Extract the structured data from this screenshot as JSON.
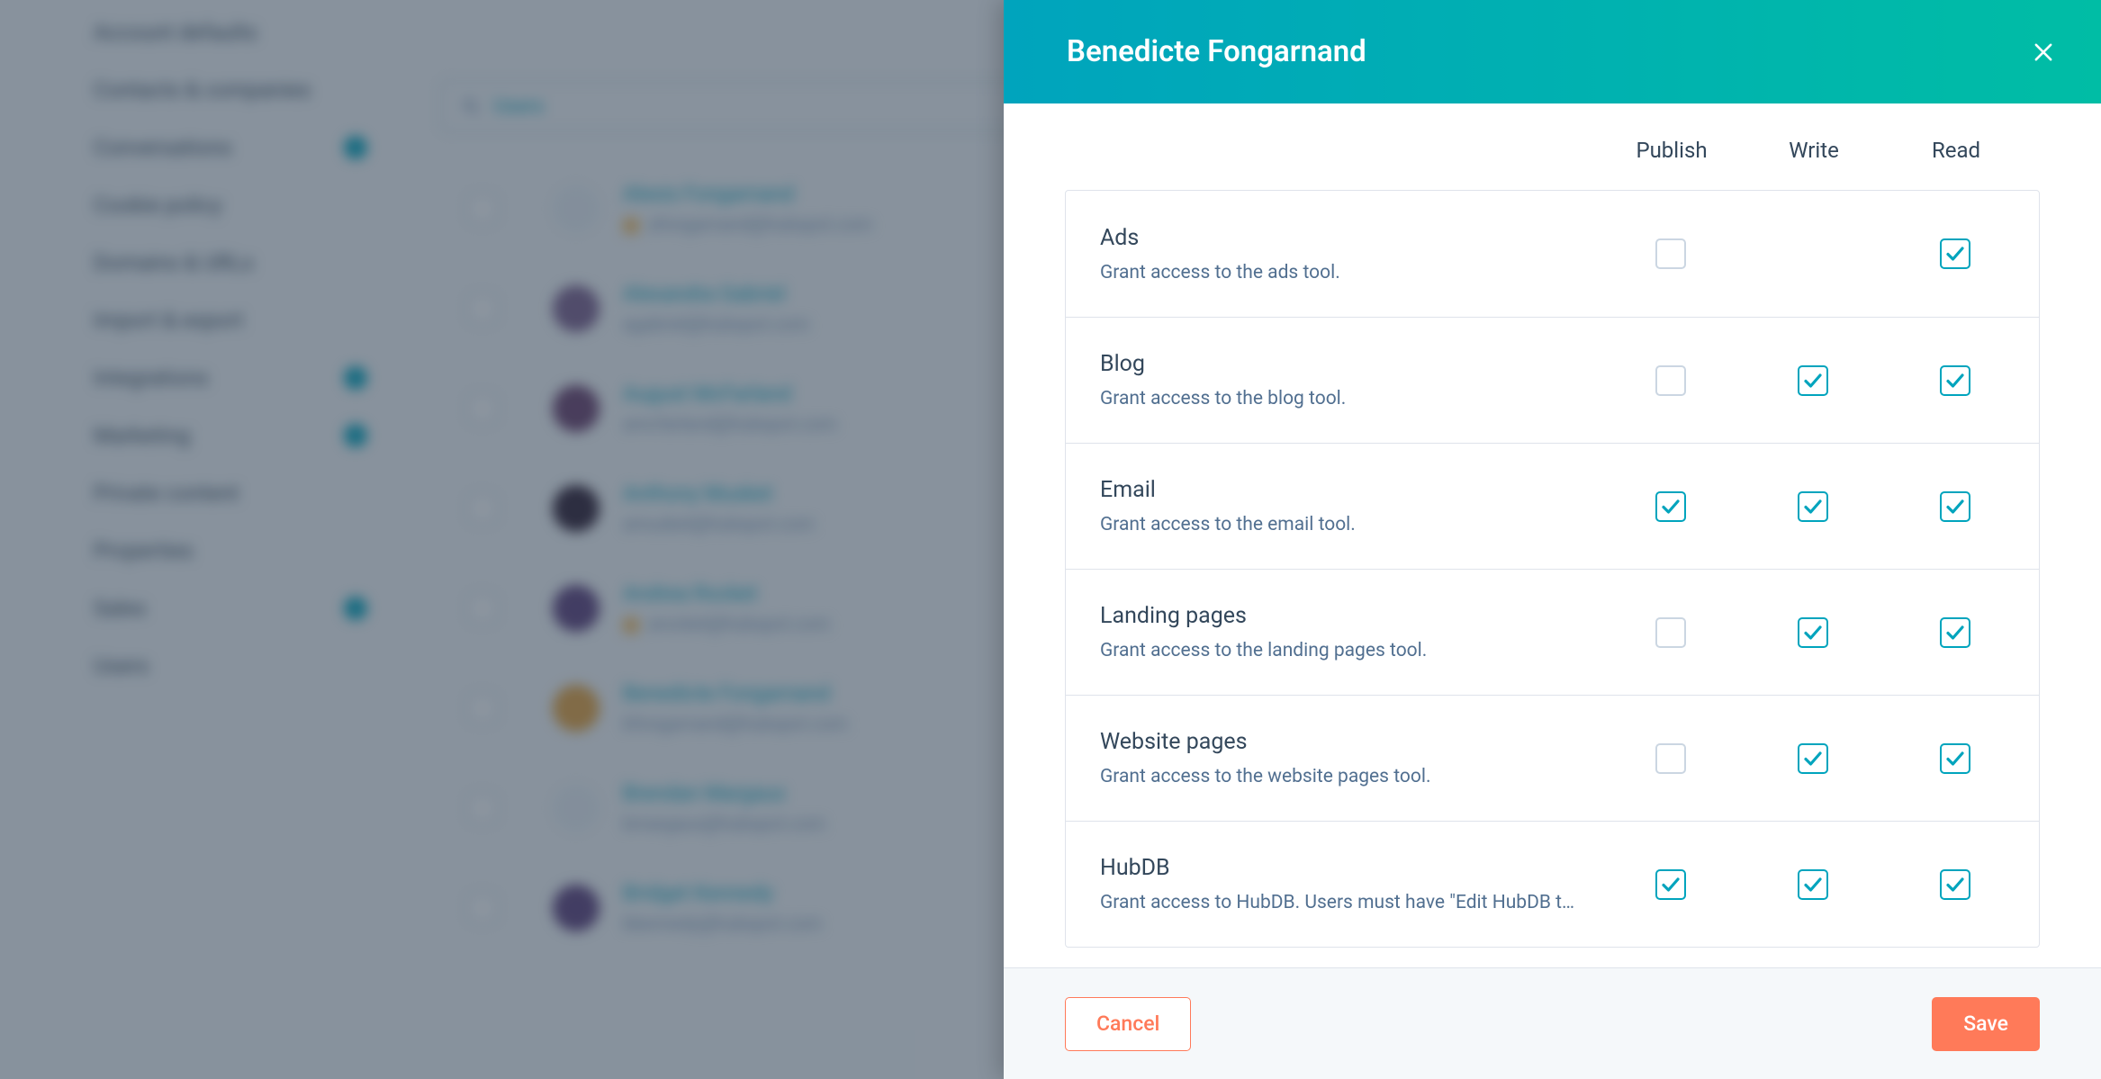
{
  "colors": {
    "accent_teal": "#00a4bd",
    "accent_orange": "#ff7a59",
    "text_primary": "#33475b",
    "text_secondary": "#516f90"
  },
  "background_page": {
    "sidebar": {
      "items": [
        {
          "label": "Account defaults",
          "badge": false
        },
        {
          "label": "Contacts & companies",
          "badge": false
        },
        {
          "label": "Conversations",
          "badge": true
        },
        {
          "label": "Cookie policy",
          "badge": false
        },
        {
          "label": "Domains & URLs",
          "badge": false
        },
        {
          "label": "Import & export",
          "badge": false
        },
        {
          "label": "Integrations",
          "badge": true
        },
        {
          "label": "Marketing",
          "badge": true
        },
        {
          "label": "Private content",
          "badge": false
        },
        {
          "label": "Properties",
          "badge": false
        },
        {
          "label": "Sales",
          "badge": true
        },
        {
          "label": "Users",
          "badge": false
        }
      ]
    },
    "search_text": "Users",
    "rows": [
      {
        "name": "Alexis Fongarnand",
        "email": "afongarnand@hubspot.com",
        "warn": true,
        "avatar_color": "#eaf0f6"
      },
      {
        "name": "Alexandra Gabriel",
        "email": "agabriel@hubspot.com",
        "warn": false,
        "avatar_color": "#7c5e8c"
      },
      {
        "name": "August McFarland",
        "email": "amcfarland@hubspot.com",
        "warn": false,
        "avatar_color": "#6a3d6a"
      },
      {
        "name": "Anthony Musket",
        "email": "amusket@hubspot.com",
        "warn": false,
        "avatar_color": "#2d1b2f"
      },
      {
        "name": "Andrea Rocket",
        "email": "arocket@hubspot.com",
        "warn": true,
        "avatar_color": "#5c3d7a"
      },
      {
        "name": "Benedicte Fongarnand",
        "email": "bfongarnand@hubspot.com",
        "warn": false,
        "avatar_color": "#e6a23c"
      },
      {
        "name": "Brendan Margaux",
        "email": "bmargaux@hubspot.com",
        "warn": false,
        "avatar_color": "#eaf0f6"
      },
      {
        "name": "Bridget Kennedy",
        "email": "bkennedy@hubspot.com",
        "warn": false,
        "avatar_color": "#5c3d7a"
      }
    ]
  },
  "modal": {
    "title": "Benedicte Fongarnand",
    "columns": {
      "publish": "Publish",
      "write": "Write",
      "read": "Read"
    },
    "permissions": [
      {
        "key": "ads",
        "title": "Ads",
        "desc": "Grant access to the ads tool.",
        "publish": false,
        "write": null,
        "read": true
      },
      {
        "key": "blog",
        "title": "Blog",
        "desc": "Grant access to the blog tool.",
        "publish": false,
        "write": true,
        "read": true
      },
      {
        "key": "email",
        "title": "Email",
        "desc": "Grant access to the email tool.",
        "publish": true,
        "write": true,
        "read": true
      },
      {
        "key": "landing",
        "title": "Landing pages",
        "desc": "Grant access to the landing pages tool.",
        "publish": false,
        "write": true,
        "read": true
      },
      {
        "key": "website",
        "title": "Website pages",
        "desc": "Grant access to the website pages tool.",
        "publish": false,
        "write": true,
        "read": true
      },
      {
        "key": "hubdb",
        "title": "HubDB",
        "desc": "Grant access to HubDB. Users must have \"Edit HubDB ta…",
        "publish": true,
        "write": true,
        "read": true
      }
    ],
    "footer": {
      "cancel": "Cancel",
      "save": "Save"
    }
  }
}
